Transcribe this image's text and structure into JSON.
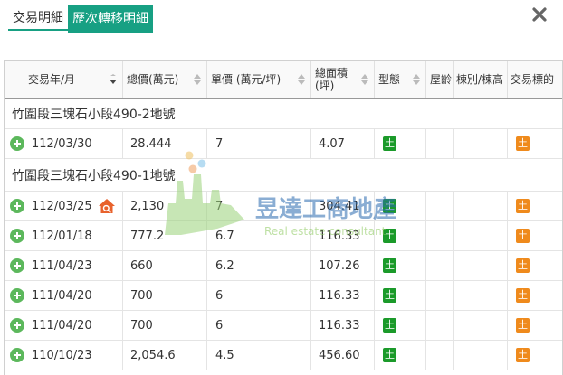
{
  "tabs": [
    {
      "label": "交易明細",
      "active": false
    },
    {
      "label": "歷次轉移明細",
      "active": true
    }
  ],
  "close_icon": "close-icon",
  "columns": [
    {
      "label": "交易年/月",
      "sort": "desc"
    },
    {
      "label": "總價(萬元)",
      "sort": "both"
    },
    {
      "label": "單價 (萬元/坪)",
      "sort": "both"
    },
    {
      "label": "總面積 (坪)",
      "sort": "both"
    },
    {
      "label": "型態",
      "sort": "both"
    },
    {
      "label": "屋齡",
      "sort": "none"
    },
    {
      "label": "棟別/棟高",
      "sort": "none"
    },
    {
      "label": "交易標的",
      "sort": "none"
    }
  ],
  "groups": [
    {
      "title": "竹圍段三塊石小段490-2地號",
      "rows": [
        {
          "date": "112/03/30",
          "total": "28.444",
          "unit": "7",
          "area": "4.07",
          "type": "土",
          "age": "",
          "building": "",
          "target": "土",
          "has_house_icon": false
        }
      ]
    },
    {
      "title": "竹圍段三塊石小段490-1地號",
      "rows": [
        {
          "date": "112/03/25",
          "total": "2,130",
          "unit": "7",
          "area": "304.41",
          "type": "土",
          "age": "",
          "building": "",
          "target": "土",
          "has_house_icon": true
        },
        {
          "date": "112/01/18",
          "total": "777.2",
          "unit": "6.7",
          "area": "116.33",
          "type": "土",
          "age": "",
          "building": "",
          "target": "土",
          "has_house_icon": false
        },
        {
          "date": "111/04/23",
          "total": "660",
          "unit": "6.2",
          "area": "107.26",
          "type": "土",
          "age": "",
          "building": "",
          "target": "土",
          "has_house_icon": false
        },
        {
          "date": "111/04/20",
          "total": "700",
          "unit": "6",
          "area": "116.33",
          "type": "土",
          "age": "",
          "building": "",
          "target": "土",
          "has_house_icon": false
        },
        {
          "date": "111/04/20",
          "total": "700",
          "unit": "6",
          "area": "116.33",
          "type": "土",
          "age": "",
          "building": "",
          "target": "土",
          "has_house_icon": false
        },
        {
          "date": "110/10/23",
          "total": "2,054.6",
          "unit": "4.5",
          "area": "456.60",
          "type": "土",
          "age": "",
          "building": "",
          "target": "土",
          "has_house_icon": false
        }
      ]
    }
  ],
  "watermark": {
    "title": "昱達工商地產",
    "subtitle": "Real estate consultant"
  },
  "colors": {
    "accent": "#17a083",
    "type_badge": "#1b9a2a",
    "target_badge": "#ef8a1c",
    "plus": "#5cb85c",
    "house_icon": "#e8622c"
  }
}
